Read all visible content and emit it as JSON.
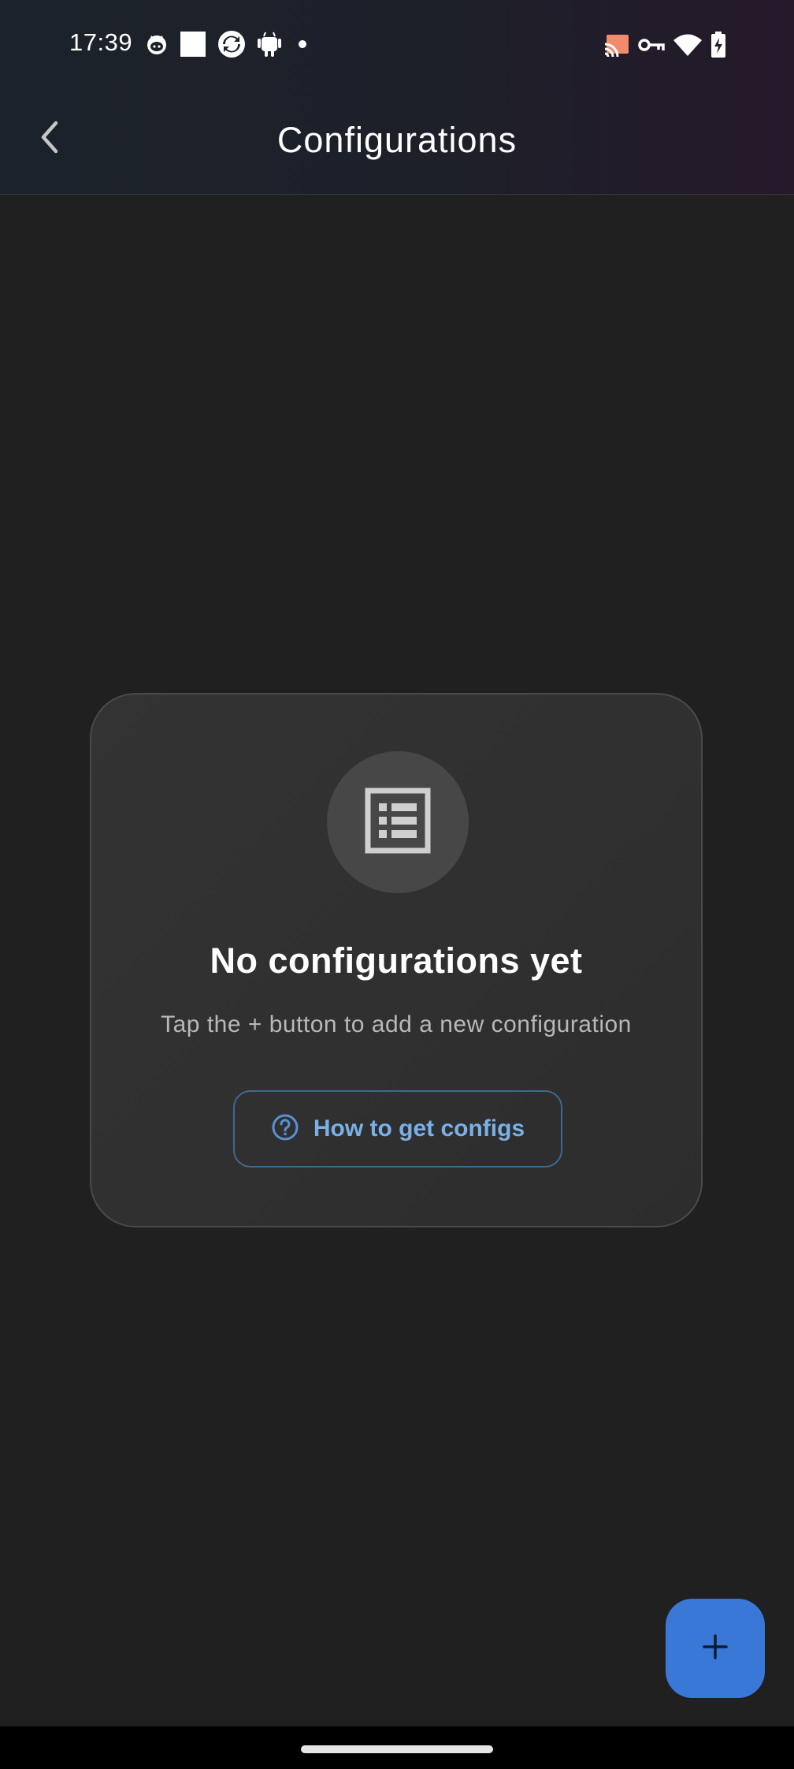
{
  "status_bar": {
    "time": "17:39",
    "left_icons": [
      "notification-cat-icon",
      "notification-square-icon",
      "notification-sync-icon",
      "notification-android-icon",
      "notification-dot-icon"
    ],
    "right_icons": [
      "cast-icon",
      "vpn-key-icon",
      "wifi-icon",
      "battery-charging-icon"
    ]
  },
  "app_bar": {
    "title": "Configurations",
    "back_icon": "chevron-left-icon"
  },
  "empty_state": {
    "icon": "list-document-icon",
    "title": "No configurations yet",
    "subtitle": "Tap the + button to add a new configuration",
    "help_button": {
      "icon": "help-circle-icon",
      "label": "How to get configs"
    }
  },
  "fab": {
    "icon": "plus-icon"
  },
  "colors": {
    "background": "#202020",
    "card": "#303030",
    "accent": "#3a78d8",
    "link": "#7ab0e6"
  }
}
